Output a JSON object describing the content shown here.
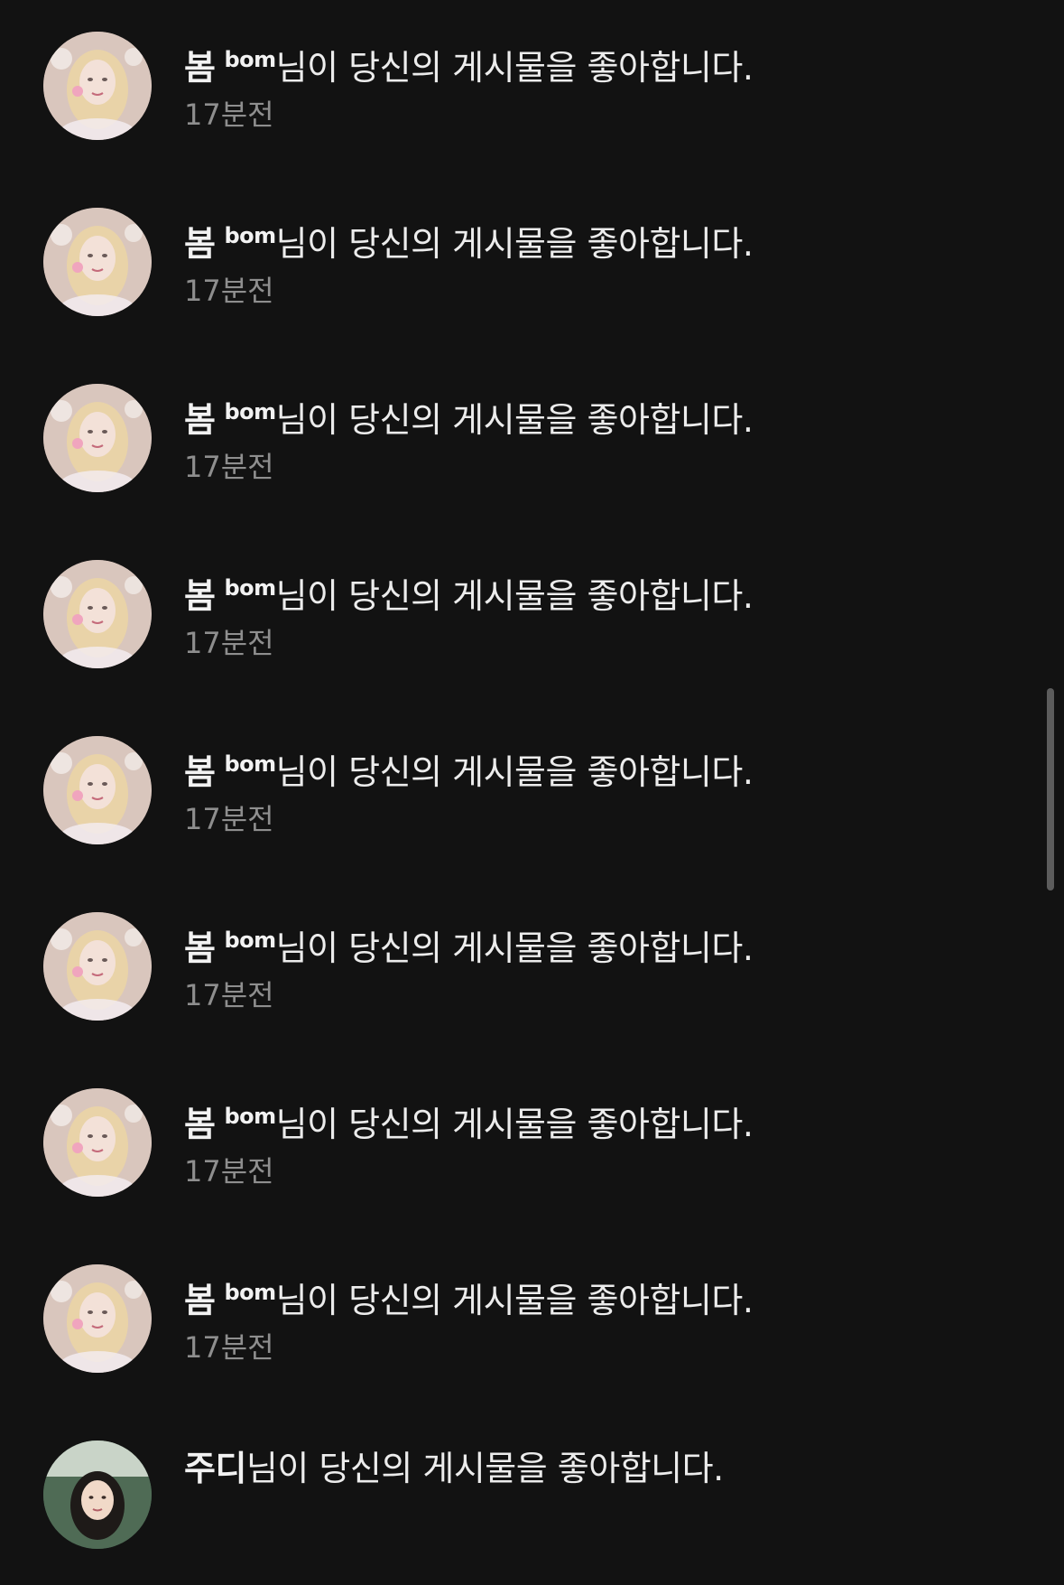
{
  "notifications": [
    {
      "username": "봄",
      "username_sup": "bom",
      "message": "님이 당신의 게시물을 좋아합니다.",
      "time": "17분전",
      "avatar": "avatar-blonde-woman"
    },
    {
      "username": "봄",
      "username_sup": "bom",
      "message": "님이 당신의 게시물을 좋아합니다.",
      "time": "17분전",
      "avatar": "avatar-blonde-woman"
    },
    {
      "username": "봄",
      "username_sup": "bom",
      "message": "님이 당신의 게시물을 좋아합니다.",
      "time": "17분전",
      "avatar": "avatar-blonde-woman"
    },
    {
      "username": "봄",
      "username_sup": "bom",
      "message": "님이 당신의 게시물을 좋아합니다.",
      "time": "17분전",
      "avatar": "avatar-blonde-woman"
    },
    {
      "username": "봄",
      "username_sup": "bom",
      "message": "님이 당신의 게시물을 좋아합니다.",
      "time": "17분전",
      "avatar": "avatar-blonde-woman"
    },
    {
      "username": "봄",
      "username_sup": "bom",
      "message": "님이 당신의 게시물을 좋아합니다.",
      "time": "17분전",
      "avatar": "avatar-blonde-woman"
    },
    {
      "username": "봄",
      "username_sup": "bom",
      "message": "님이 당신의 게시물을 좋아합니다.",
      "time": "17분전",
      "avatar": "avatar-blonde-woman"
    },
    {
      "username": "봄",
      "username_sup": "bom",
      "message": "님이 당신의 게시물을 좋아합니다.",
      "time": "17분전",
      "avatar": "avatar-blonde-woman"
    },
    {
      "username": "주디",
      "username_sup": "",
      "message": "님이 당신의 게시물을 좋아합니다.",
      "time": "",
      "avatar": "avatar-dark-hair-woman"
    }
  ],
  "theme": {
    "background": "#121212",
    "text": "#ececec",
    "muted": "#8e8e8e",
    "scrollbar": "#5c5c5c"
  }
}
